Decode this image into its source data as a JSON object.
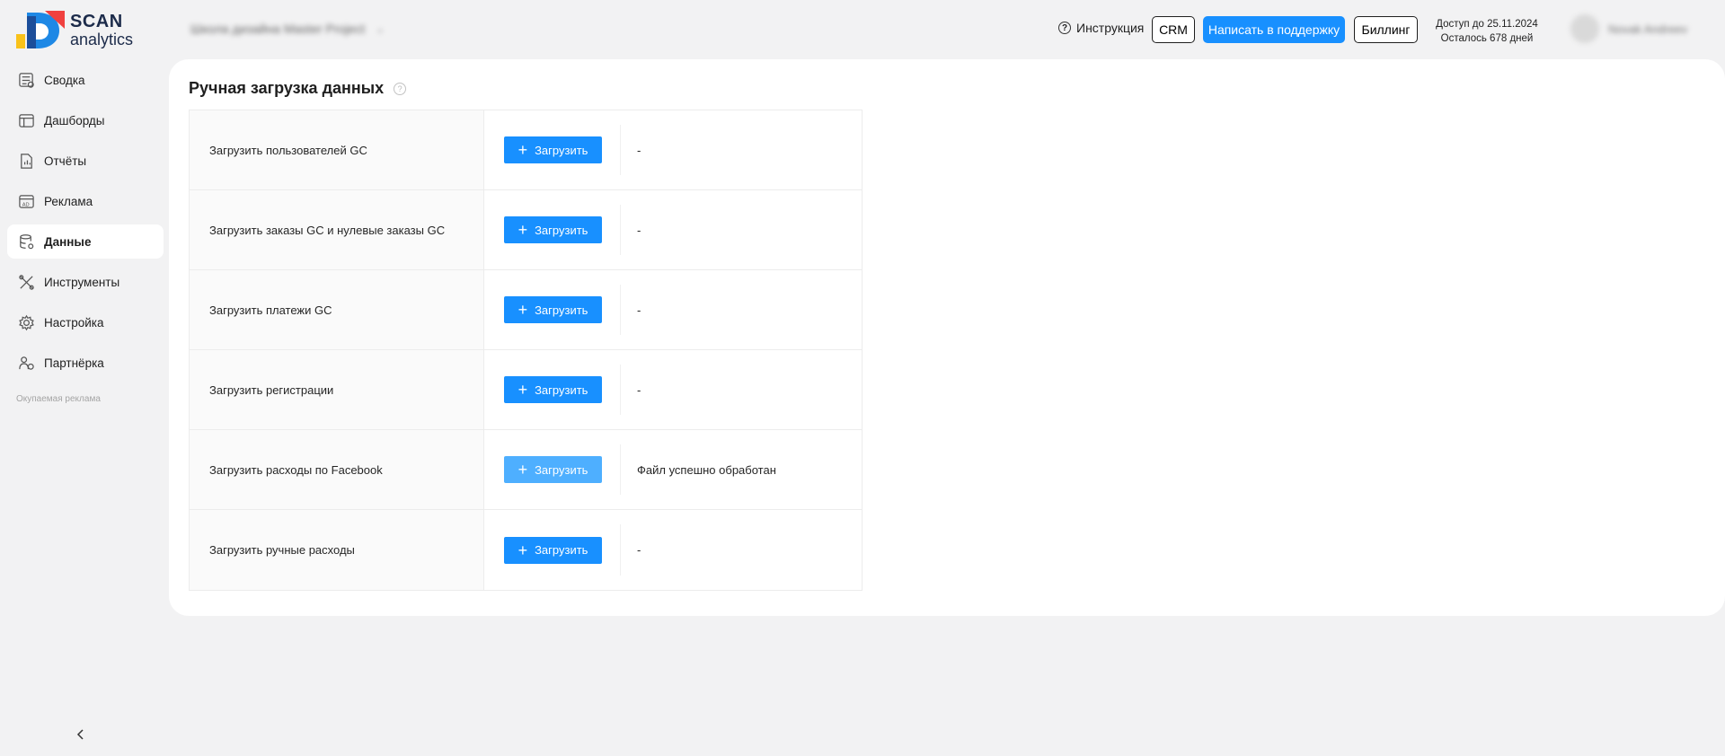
{
  "brand": {
    "name_line1": "SCAN",
    "name_line2": "analytics",
    "colors": {
      "blue": "#1e88e5",
      "red": "#f0413f",
      "yellow": "#f9c21a",
      "navy": "#1c2b4a"
    }
  },
  "header": {
    "project_name": "Школа дизайна Master Project",
    "instruction_label": "Инструкция",
    "crm_label": "CRM",
    "support_label": "Написать в поддержку",
    "billing_label": "Биллинг",
    "access_until": "Доступ до 25.11.2024",
    "days_left": "Осталось 678 дней",
    "user_name": "Novak Andreev"
  },
  "sidebar": {
    "items": [
      {
        "label": "Сводка",
        "icon": "summary-icon"
      },
      {
        "label": "Дашборды",
        "icon": "dashboard-icon"
      },
      {
        "label": "Отчёты",
        "icon": "report-icon"
      },
      {
        "label": "Реклама",
        "icon": "ad-icon"
      },
      {
        "label": "Данные",
        "icon": "database-icon",
        "active": true
      },
      {
        "label": "Инструменты",
        "icon": "tools-icon"
      },
      {
        "label": "Настройка",
        "icon": "settings-icon"
      },
      {
        "label": "Партнёрка",
        "icon": "partner-icon"
      }
    ],
    "muted_label": "Окупаемая реклама"
  },
  "main": {
    "title": "Ручная загрузка данных",
    "upload_label": "Загрузить",
    "rows": [
      {
        "label": "Загрузить пользователей GC",
        "status": "-"
      },
      {
        "label": "Загрузить заказы GC и нулевые заказы GC",
        "status": "-"
      },
      {
        "label": "Загрузить платежи GC",
        "status": "-"
      },
      {
        "label": "Загрузить регистрации",
        "status": "-"
      },
      {
        "label": "Загрузить расходы по Facebook",
        "status": "Файл успешно обработан"
      },
      {
        "label": "Загрузить ручные расходы",
        "status": "-"
      }
    ]
  }
}
